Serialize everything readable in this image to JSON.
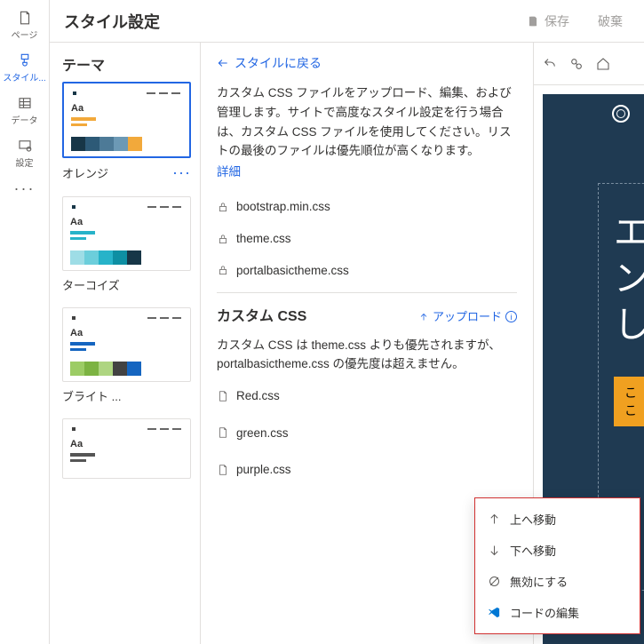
{
  "rail": {
    "page": {
      "label": "ページ"
    },
    "style": {
      "label": "スタイル..."
    },
    "data": {
      "label": "データ"
    },
    "setup": {
      "label": "設定"
    }
  },
  "topbar": {
    "title": "スタイル設定",
    "save": "保存",
    "discard": "破棄"
  },
  "themes": {
    "header": "テーマ",
    "items": [
      {
        "label": "オレンジ",
        "accent": "#f2a93b",
        "bar": "#173647",
        "sw": [
          "#173647",
          "#2d5a77",
          "#4d7a97",
          "#6c99b5",
          "#f2a93b"
        ]
      },
      {
        "label": "ターコイズ",
        "accent": "#27b3c9",
        "bar": "#173647",
        "sw": [
          "#9edde6",
          "#6ccedb",
          "#27b3c9",
          "#0e8fa3",
          "#173647"
        ]
      },
      {
        "label": "ブライト ...",
        "accent": "#1565c0",
        "bar": "#424242",
        "sw": [
          "#9ccc65",
          "#7cb342",
          "#aed581",
          "#424242",
          "#1565c0"
        ]
      },
      {
        "label": "",
        "accent": "#555",
        "bar": "#424242",
        "sw": []
      }
    ]
  },
  "css": {
    "back": "スタイルに戻る",
    "desc": "カスタム CSS ファイルをアップロード、編集、および管理します。サイトで高度なスタイル設定を行う場合は、カスタム CSS ファイルを使用してください。リストの最後のファイルは優先順位が高くなります。",
    "detail": "詳細",
    "locked": [
      "bootstrap.min.css",
      "theme.css",
      "portalbasictheme.css"
    ],
    "custom_title": "カスタム CSS",
    "upload": "アップロード",
    "custom_desc": "カスタム CSS は theme.css よりも優先されますが、portalbasictheme.css の優先度は超えません。",
    "custom_files": [
      "Red.css",
      "green.css",
      "purple.css"
    ]
  },
  "preview": {
    "headline": "エ\nン\nし",
    "cta": "ここ"
  },
  "ctx": {
    "up": "上へ移動",
    "down": "下へ移動",
    "disable": "無効にする",
    "edit": "コードの編集"
  }
}
